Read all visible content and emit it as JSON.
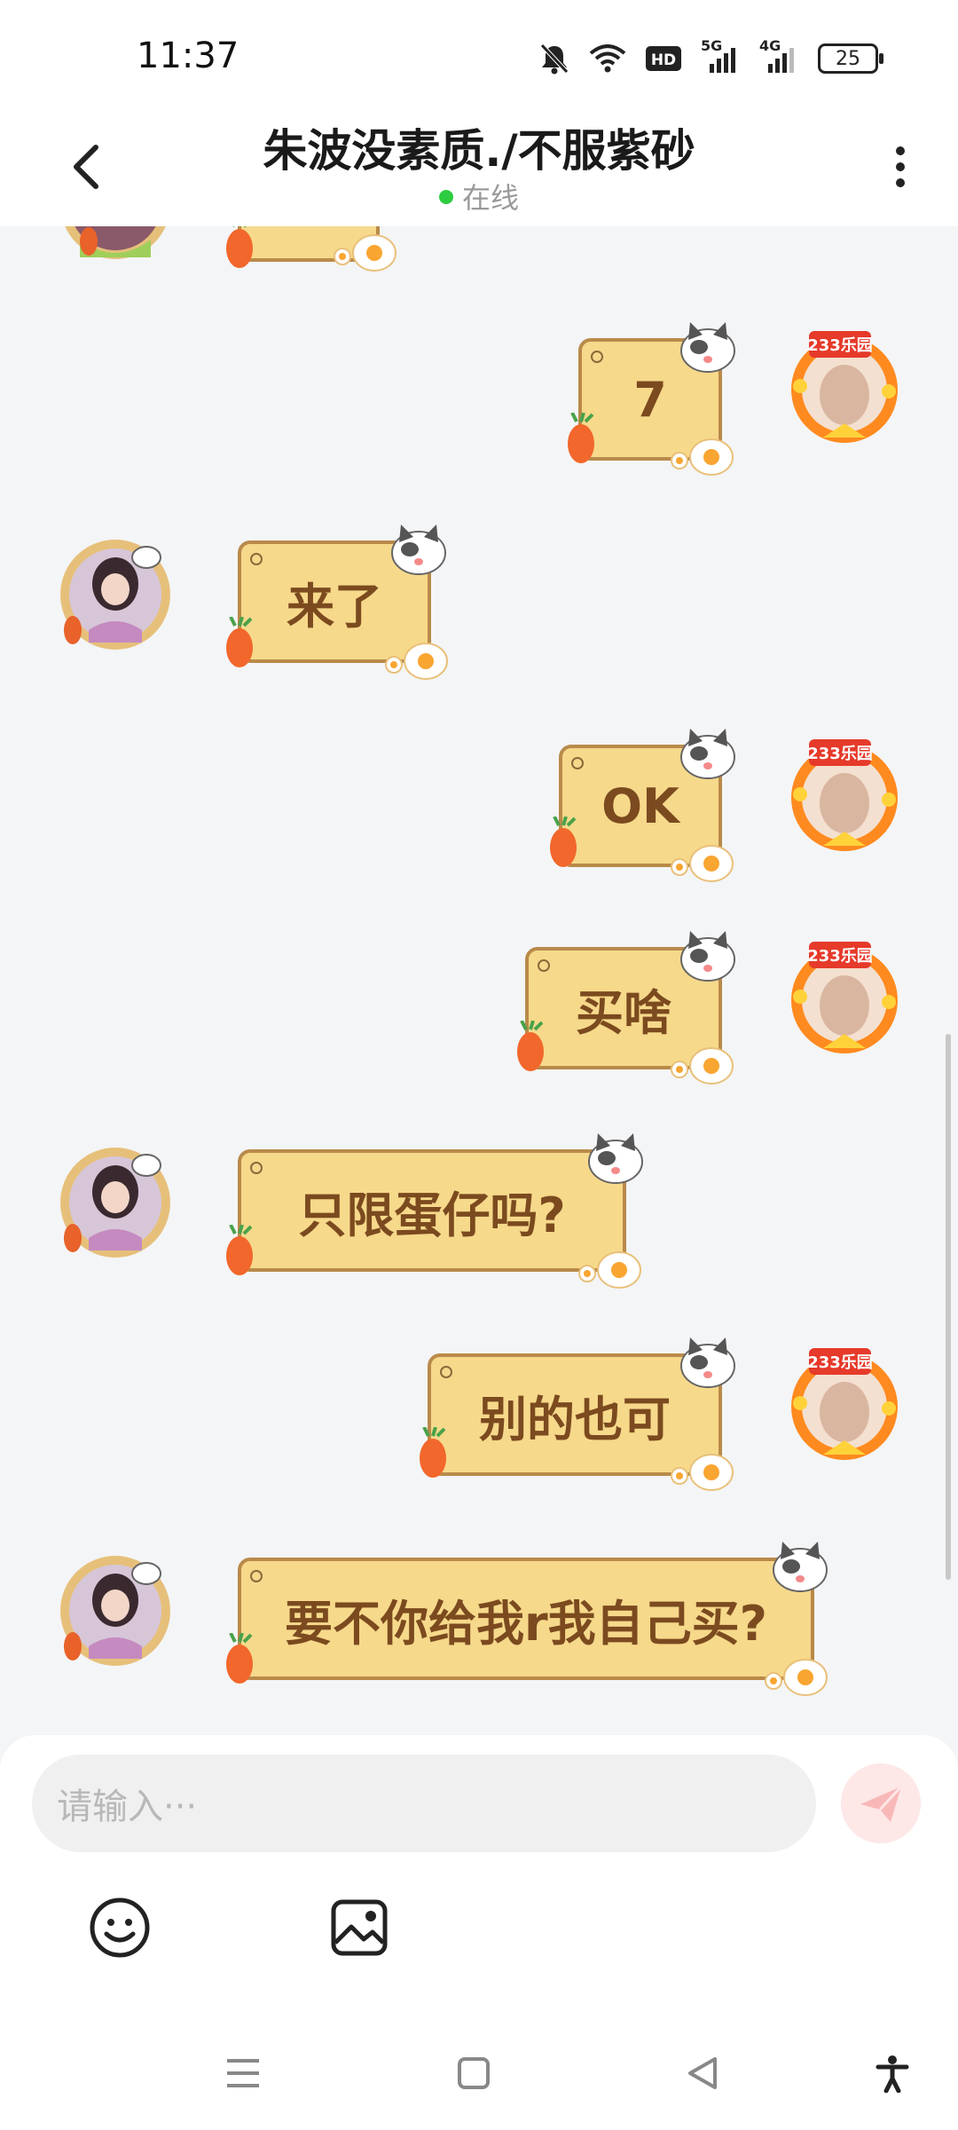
{
  "status_bar": {
    "time": "11:37",
    "network_label_1": "5G",
    "network_label_2": "4G",
    "battery": "25"
  },
  "header": {
    "title": "朱波没素质./不服紫砂",
    "status": "在线",
    "status_color": "#2ecc40"
  },
  "messages": [
    {
      "side": "right",
      "text": "7"
    },
    {
      "side": "left",
      "text": "来了"
    },
    {
      "side": "right",
      "text": "OK"
    },
    {
      "side": "right",
      "text": "买啥"
    },
    {
      "side": "left",
      "text": "只限蛋仔吗?"
    },
    {
      "side": "right",
      "text": "别的也可"
    },
    {
      "side": "left",
      "text": "要不你给我r我自己买?"
    }
  ],
  "avatar_badge": "233乐园",
  "input": {
    "placeholder": "请输入···"
  },
  "toolbar": {
    "icons": [
      "smiley-icon",
      "image-icon"
    ]
  },
  "colors": {
    "bubble_fill": "#f6d98b",
    "bubble_border": "#b98a4a",
    "bubble_text": "#7b4a1f",
    "send_button": "#fde7e7"
  }
}
